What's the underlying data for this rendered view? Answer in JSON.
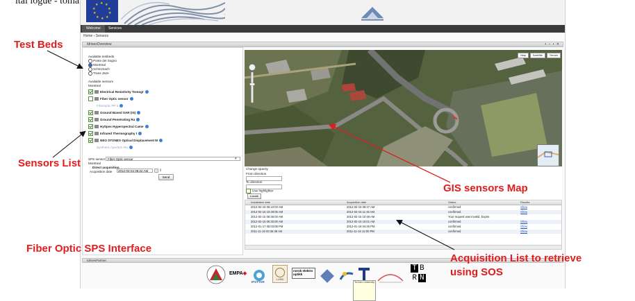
{
  "caption": {
    "text": "ital logue - tomatic SOS access"
  },
  "app": {
    "nav": {
      "home": "Welcome",
      "services": "Services"
    },
    "breadcrumb": "Home › Sensors",
    "panel_title": "IdrisesOverview",
    "panel_tools": "▪ – ▪ ✕",
    "left": {
      "testbeds_heading": "Available testbeds",
      "testbeds": [
        {
          "label": "Ponte del Sogno",
          "selected": false
        },
        {
          "label": "Montreal",
          "selected": true
        },
        {
          "label": "Schinznach",
          "selected": false
        },
        {
          "label": "Trans Jäze",
          "selected": false
        }
      ],
      "sensors_heading": "Available sensors",
      "sensors_sub": "Montreal",
      "sensors": [
        {
          "label": "Electrical Resistivity Tomogr",
          "checked": true,
          "muted": false,
          "icon": "resistivity-icon"
        },
        {
          "label": "Fiber Optic sensor",
          "checked": false,
          "muted": false,
          "icon": "fiber-icon"
        },
        {
          "label": "Fiberoptic PP 3",
          "checked": false,
          "muted": true,
          "icon": ""
        },
        {
          "label": "Ground Based SAR (IS)",
          "checked": true,
          "muted": false,
          "icon": "sar-icon"
        },
        {
          "label": "Ground Penetrating Ra",
          "checked": true,
          "muted": false,
          "icon": "gpr-icon"
        },
        {
          "label": "HySpex Hyperspectral Came",
          "checked": true,
          "muted": false,
          "icon": "camera-icon"
        },
        {
          "label": "Infrared Thermography I",
          "checked": true,
          "muted": false,
          "icon": "thermo-icon"
        },
        {
          "label": "NEO STONES Optical Displacement M",
          "checked": true,
          "muted": false,
          "icon": "optical-icon"
        },
        {
          "label": "Synthetic Aperture Ra",
          "checked": false,
          "muted": true,
          "icon": ""
        }
      ],
      "sps_label": "SPS sensor",
      "sps_sub": "Montreal",
      "sps_value": "Fiber Optic sensor",
      "direct_acq_label": "Direct acquisition",
      "acq_date_label": "Acquisition date",
      "acq_date_value": "2012-04-04 08:22 AM",
      "send_label": "Send"
    },
    "map": {
      "buttons": [
        "Map",
        "Satellite",
        "Terrain"
      ],
      "change_opacity": "Change opacity",
      "from_label": "From direction",
      "to_label": "To direction",
      "use_highlight": "Use highlighter",
      "locate_label": "Locate"
    },
    "grid": {
      "columns": [
        "Installation date",
        "Acquisition date",
        "Status",
        "Results"
      ],
      "rows": [
        {
          "install": "2012-02-15 06:10:03 AM",
          "acq": "2012-02-15 08:47 AM",
          "status": "confirmed",
          "result": "Show"
        },
        {
          "install": "2012-02-15 10:29:05 AM",
          "acq": "2012-02-15 11:15 AM",
          "status": "confirmed",
          "result": "Show"
        },
        {
          "install": "2012-02-15 06:36:03 AM",
          "acq": "2012-02-15 10:48 AM",
          "status": "Your request was invalid. Expire",
          "result": ""
        },
        {
          "install": "2012-02-15 06:30:00 AM",
          "acq": "2012-02-15 10:01 AM",
          "status": "confirmed",
          "result": "Show"
        },
        {
          "install": "2012-01-17 05:03:08 PM",
          "acq": "2012-01-18 04:40 PM",
          "status": "confirmed",
          "result": "Show"
        },
        {
          "install": "2011-11-16 03:36:48 AM",
          "acq": "2011-11-16 12:00 PM",
          "status": "confirmed",
          "result": "Show"
        }
      ]
    },
    "footer_title": "IdrisesPartner",
    "logos": {
      "empa": "EMPA",
      "ifsttar": "IFSTTAR",
      "lund": "LUND",
      "norsk": "norsk elektro optikk",
      "tbn": [
        "T",
        "B",
        "R",
        "N"
      ],
      "tau": "Tel Aviv University"
    }
  },
  "annotations": {
    "test_beds": "Test Beds",
    "sensors_list": "Sensors List",
    "gis_map": "GIS sensors Map",
    "fiber_sps": "Fiber Optic SPS Interface",
    "acq_list_line1": "Acquisition List to retrieve",
    "acq_list_line2": "using SOS"
  },
  "colors": {
    "annotation": "#e01c1c",
    "nav_bar": "#3a3a3a",
    "link": "#1f55c7"
  }
}
